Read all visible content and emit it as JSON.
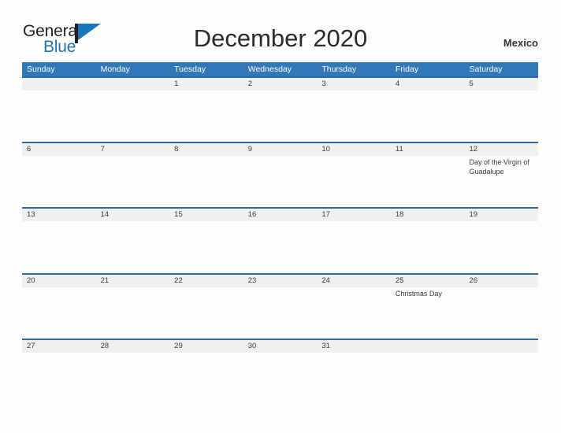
{
  "brand": {
    "name_part1": "General",
    "name_part2": "Blue",
    "logo_icon": "flag-icon"
  },
  "header": {
    "title": "December 2020",
    "region": "Mexico"
  },
  "calendar": {
    "month": "December",
    "year": "2020",
    "weekday_headers": [
      "Sunday",
      "Monday",
      "Tuesday",
      "Wednesday",
      "Thursday",
      "Friday",
      "Saturday"
    ],
    "accent_color": "#3277b8",
    "separator_color": "#2b6ca8",
    "date_band_color": "#f0f0f0",
    "weeks": [
      {
        "days": [
          {
            "num": "",
            "event": ""
          },
          {
            "num": "",
            "event": ""
          },
          {
            "num": "1",
            "event": ""
          },
          {
            "num": "2",
            "event": ""
          },
          {
            "num": "3",
            "event": ""
          },
          {
            "num": "4",
            "event": ""
          },
          {
            "num": "5",
            "event": ""
          }
        ]
      },
      {
        "days": [
          {
            "num": "6",
            "event": ""
          },
          {
            "num": "7",
            "event": ""
          },
          {
            "num": "8",
            "event": ""
          },
          {
            "num": "9",
            "event": ""
          },
          {
            "num": "10",
            "event": ""
          },
          {
            "num": "11",
            "event": ""
          },
          {
            "num": "12",
            "event": "Day of the Virgin of Guadalupe"
          }
        ]
      },
      {
        "days": [
          {
            "num": "13",
            "event": ""
          },
          {
            "num": "14",
            "event": ""
          },
          {
            "num": "15",
            "event": ""
          },
          {
            "num": "16",
            "event": ""
          },
          {
            "num": "17",
            "event": ""
          },
          {
            "num": "18",
            "event": ""
          },
          {
            "num": "19",
            "event": ""
          }
        ]
      },
      {
        "days": [
          {
            "num": "20",
            "event": ""
          },
          {
            "num": "21",
            "event": ""
          },
          {
            "num": "22",
            "event": ""
          },
          {
            "num": "23",
            "event": ""
          },
          {
            "num": "24",
            "event": ""
          },
          {
            "num": "25",
            "event": "Christmas Day"
          },
          {
            "num": "26",
            "event": ""
          }
        ]
      },
      {
        "days": [
          {
            "num": "27",
            "event": ""
          },
          {
            "num": "28",
            "event": ""
          },
          {
            "num": "29",
            "event": ""
          },
          {
            "num": "30",
            "event": ""
          },
          {
            "num": "31",
            "event": ""
          },
          {
            "num": "",
            "event": ""
          },
          {
            "num": "",
            "event": ""
          }
        ]
      }
    ]
  }
}
